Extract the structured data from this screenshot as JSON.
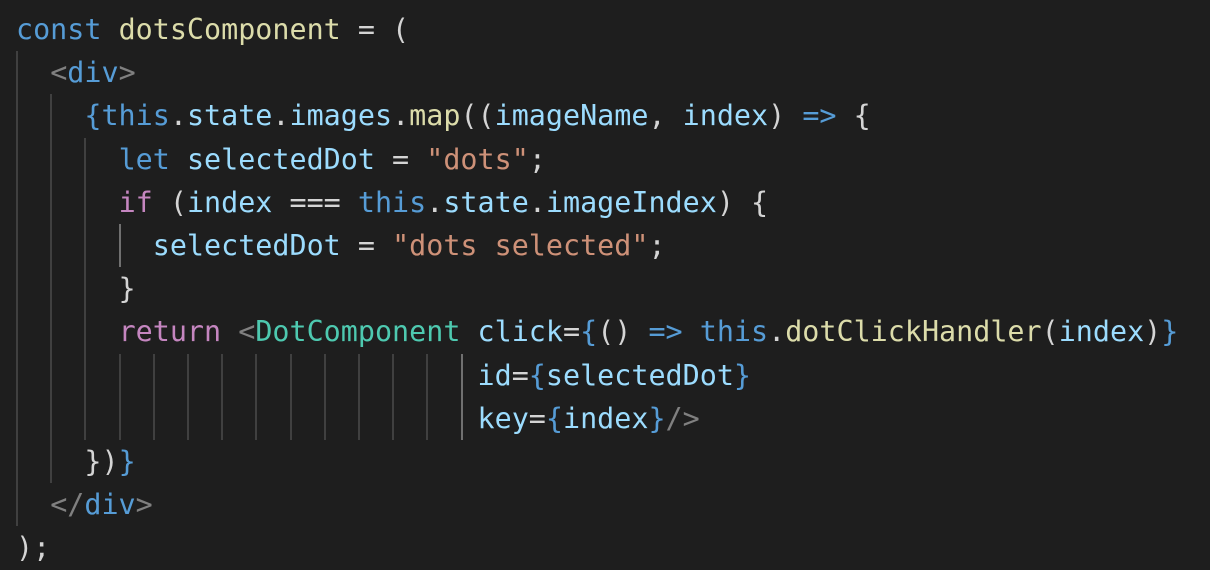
{
  "editor": {
    "theme_colors": {
      "background": "#1e1e1e",
      "keyword": "#569cd6",
      "control": "#c586c0",
      "function": "#dcdcaa",
      "variable": "#9cdcfe",
      "string": "#ce9178",
      "component": "#4ec9b0",
      "punctuation": "#d4d4d4",
      "tag_bracket": "#808080"
    },
    "lines": [
      [
        {
          "t": "const",
          "c": "kw"
        },
        {
          "t": " "
        },
        {
          "t": "dotsComponent",
          "c": "fn"
        },
        {
          "t": " = ("
        }
      ],
      [
        {
          "t": "  "
        },
        {
          "t": "<",
          "c": "br"
        },
        {
          "t": "div",
          "c": "tag"
        },
        {
          "t": ">",
          "c": "br"
        }
      ],
      [
        {
          "t": "    "
        },
        {
          "t": "{",
          "c": "brace"
        },
        {
          "t": "this",
          "c": "kw"
        },
        {
          "t": "."
        },
        {
          "t": "state",
          "c": "var"
        },
        {
          "t": "."
        },
        {
          "t": "images",
          "c": "var"
        },
        {
          "t": "."
        },
        {
          "t": "map",
          "c": "fn"
        },
        {
          "t": "(("
        },
        {
          "t": "imageName",
          "c": "var"
        },
        {
          "t": ", "
        },
        {
          "t": "index",
          "c": "var"
        },
        {
          "t": ") "
        },
        {
          "t": "=>",
          "c": "arrow"
        },
        {
          "t": " {"
        }
      ],
      [
        {
          "t": "      "
        },
        {
          "t": "let",
          "c": "kw"
        },
        {
          "t": " "
        },
        {
          "t": "selectedDot",
          "c": "var"
        },
        {
          "t": " = "
        },
        {
          "t": "\"dots\"",
          "c": "str"
        },
        {
          "t": ";"
        }
      ],
      [
        {
          "t": "      "
        },
        {
          "t": "if",
          "c": "ctl"
        },
        {
          "t": " ("
        },
        {
          "t": "index",
          "c": "var"
        },
        {
          "t": " === "
        },
        {
          "t": "this",
          "c": "kw"
        },
        {
          "t": "."
        },
        {
          "t": "state",
          "c": "var"
        },
        {
          "t": "."
        },
        {
          "t": "imageIndex",
          "c": "var"
        },
        {
          "t": ") {"
        }
      ],
      [
        {
          "t": "        "
        },
        {
          "t": "selectedDot",
          "c": "var"
        },
        {
          "t": " = "
        },
        {
          "t": "\"dots selected\"",
          "c": "str"
        },
        {
          "t": ";"
        }
      ],
      [
        {
          "t": "      }"
        }
      ],
      [
        {
          "t": "      "
        },
        {
          "t": "return",
          "c": "ctl"
        },
        {
          "t": " "
        },
        {
          "t": "<",
          "c": "br"
        },
        {
          "t": "DotComponent",
          "c": "cmp"
        },
        {
          "t": " "
        },
        {
          "t": "click",
          "c": "var"
        },
        {
          "t": "="
        },
        {
          "t": "{",
          "c": "brace"
        },
        {
          "t": "() "
        },
        {
          "t": "=>",
          "c": "arrow"
        },
        {
          "t": " "
        },
        {
          "t": "this",
          "c": "kw"
        },
        {
          "t": "."
        },
        {
          "t": "dotClickHandler",
          "c": "fn"
        },
        {
          "t": "("
        },
        {
          "t": "index",
          "c": "var"
        },
        {
          "t": ")"
        },
        {
          "t": "}",
          "c": "brace"
        }
      ],
      [
        {
          "t": "                           "
        },
        {
          "t": "id",
          "c": "var"
        },
        {
          "t": "="
        },
        {
          "t": "{",
          "c": "brace"
        },
        {
          "t": "selectedDot",
          "c": "var"
        },
        {
          "t": "}",
          "c": "brace"
        }
      ],
      [
        {
          "t": "                           "
        },
        {
          "t": "key",
          "c": "var"
        },
        {
          "t": "="
        },
        {
          "t": "{",
          "c": "brace"
        },
        {
          "t": "index",
          "c": "var"
        },
        {
          "t": "}",
          "c": "brace"
        },
        {
          "t": "/>",
          "c": "br"
        }
      ],
      [
        {
          "t": "    "
        },
        {
          "t": "})",
          "c": "pun"
        },
        {
          "t": "}",
          "c": "brace"
        }
      ],
      [
        {
          "t": "  "
        },
        {
          "t": "</",
          "c": "br"
        },
        {
          "t": "div",
          "c": "tag"
        },
        {
          "t": ">",
          "c": "br"
        }
      ],
      [
        {
          "t": ");"
        }
      ]
    ]
  }
}
